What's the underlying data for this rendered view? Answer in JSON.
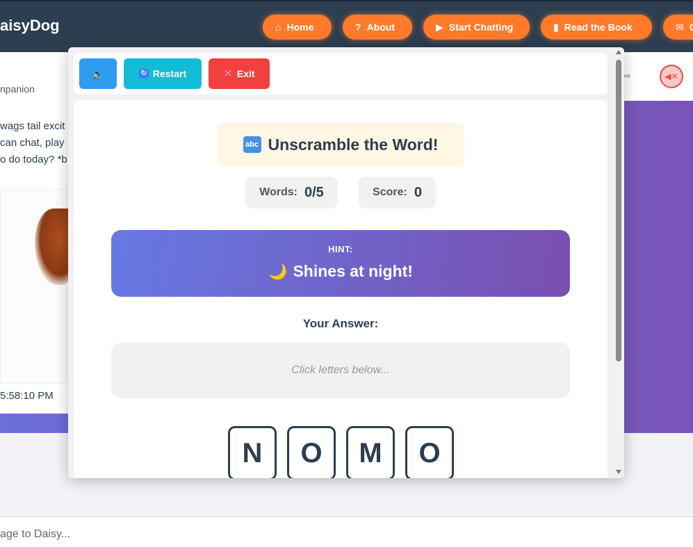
{
  "brand": "aisyDog",
  "nav": [
    {
      "label": "Home",
      "icon": "home-icon",
      "glyph": "⌂"
    },
    {
      "label": "About",
      "icon": "question-icon",
      "glyph": "?"
    },
    {
      "label": "Start Chatting",
      "icon": "play-icon",
      "glyph": "▶"
    },
    {
      "label": "Read the Book",
      "icon": "book-icon",
      "glyph": "▮"
    },
    {
      "label": "C",
      "icon": "mail-icon",
      "glyph": "✉"
    }
  ],
  "background": {
    "companion": "npanion",
    "active": "tive",
    "message_lines": [
      "wags tail excit",
      "can chat, play",
      "o do today? *b"
    ],
    "timestamp": "5:58:10 PM",
    "input_placeholder": "age to Daisy..."
  },
  "toolbar": {
    "sound_glyph": "🔈",
    "restart_label": "Restart",
    "exit_label": "Exit"
  },
  "game": {
    "title": "Unscramble the Word!",
    "title_icon": "abc",
    "words_label": "Words:",
    "words_value": "0/5",
    "score_label": "Score:",
    "score_value": "0",
    "hint_label": "HINT:",
    "hint_text": "Shines at night!",
    "hint_icon": "🌙",
    "answer_label": "Your Answer:",
    "answer_placeholder": "Click letters below...",
    "letters": [
      "N",
      "O",
      "M",
      "O"
    ]
  },
  "colors": {
    "nav_button": "#ff7a2b",
    "sound_button": "#2e9df0",
    "restart_button": "#12bcd6",
    "exit_button": "#f2403e"
  }
}
